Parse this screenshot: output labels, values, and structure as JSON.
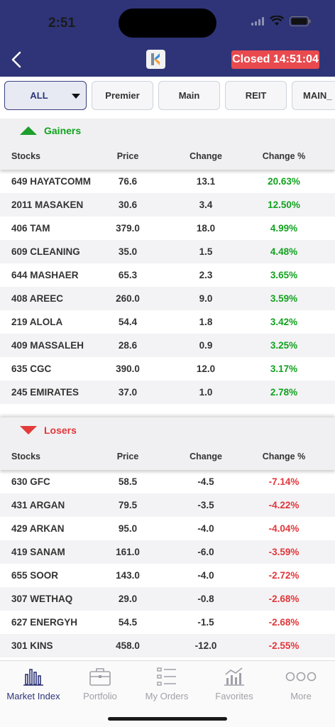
{
  "status": {
    "time": "2:51"
  },
  "header": {
    "closed_label": "Closed 14:51:04",
    "logo_letter": "K"
  },
  "filters": [
    "ALL",
    "Premier",
    "Main",
    "REIT",
    "MAIN_"
  ],
  "gainers": {
    "title": "Gainers",
    "columns": [
      "Stocks",
      "Price",
      "Change",
      "Change %"
    ],
    "rows": [
      [
        "649 HAYATCOMM",
        "76.6",
        "13.1",
        "20.63%"
      ],
      [
        "2011 MASAKEN",
        "30.6",
        "3.4",
        "12.50%"
      ],
      [
        "406 TAM",
        "379.0",
        "18.0",
        "4.99%"
      ],
      [
        "609 CLEANING",
        "35.0",
        "1.5",
        "4.48%"
      ],
      [
        "644 MASHAER",
        "65.3",
        "2.3",
        "3.65%"
      ],
      [
        "408 AREEC",
        "260.0",
        "9.0",
        "3.59%"
      ],
      [
        "219 ALOLA",
        "54.4",
        "1.8",
        "3.42%"
      ],
      [
        "409 MASSALEH",
        "28.6",
        "0.9",
        "3.25%"
      ],
      [
        "635 CGC",
        "390.0",
        "12.0",
        "3.17%"
      ],
      [
        "245 EMIRATES",
        "37.0",
        "1.0",
        "2.78%"
      ]
    ]
  },
  "losers": {
    "title": "Losers",
    "columns": [
      "Stocks",
      "Price",
      "Change",
      "Change %"
    ],
    "rows": [
      [
        "630 GFC",
        "58.5",
        "-4.5",
        "-7.14%"
      ],
      [
        "431 ARGAN",
        "79.5",
        "-3.5",
        "-4.22%"
      ],
      [
        "429 ARKAN",
        "95.0",
        "-4.0",
        "-4.04%"
      ],
      [
        "419 SANAM",
        "161.0",
        "-6.0",
        "-3.59%"
      ],
      [
        "655 SOOR",
        "143.0",
        "-4.0",
        "-2.72%"
      ],
      [
        "307 WETHAQ",
        "29.0",
        "-0.8",
        "-2.68%"
      ],
      [
        "627 ENERGYH",
        "54.5",
        "-1.5",
        "-2.68%"
      ],
      [
        "301 KINS",
        "458.0",
        "-12.0",
        "-2.55%"
      ]
    ]
  },
  "tabs": [
    {
      "label": "Market Index",
      "icon": "bar-chart-icon",
      "active": true
    },
    {
      "label": "Portfolio",
      "icon": "briefcase-icon",
      "active": false
    },
    {
      "label": "My Orders",
      "icon": "list-icon",
      "active": false
    },
    {
      "label": "Favorites",
      "icon": "trend-chart-icon",
      "active": false
    },
    {
      "label": "More",
      "icon": "more-dots-icon",
      "active": false
    }
  ],
  "colors": {
    "header": "#2e3477",
    "badge": "#e94a4e",
    "positive": "#12a21f",
    "negative": "#e2363a"
  }
}
